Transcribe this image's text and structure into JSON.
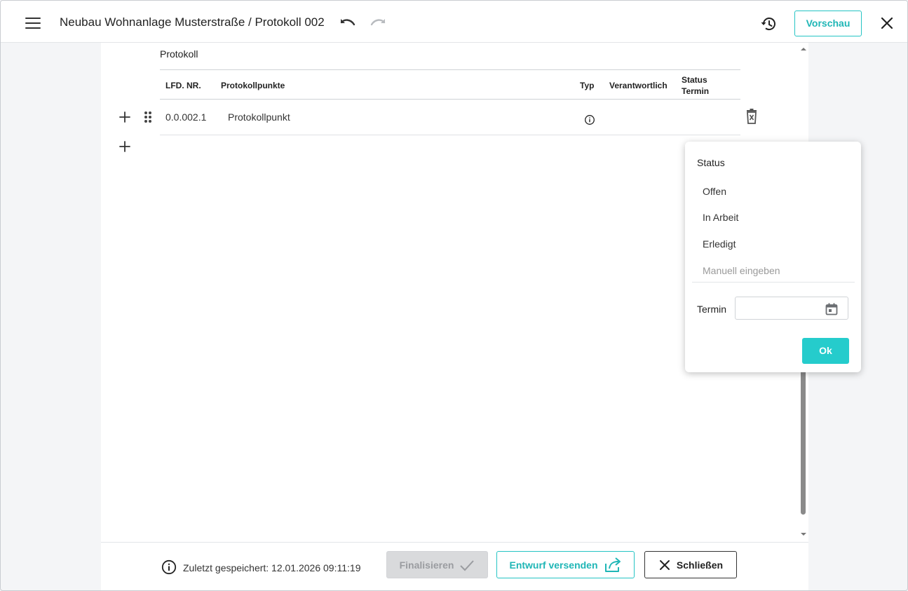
{
  "header": {
    "title": "Neubau Wohnanlage Musterstraße / Protokoll 002",
    "preview_label": "Vorschau"
  },
  "section": {
    "title": "Protokoll"
  },
  "table": {
    "headers": {
      "nr": "LFD. NR.",
      "points": "Protokollpunkte",
      "type": "Typ",
      "responsible": "Verantwortlich",
      "status_line1": "Status",
      "status_line2": "Termin"
    },
    "rows": [
      {
        "nr": "0.0.002.1",
        "point": "Protokollpunkt"
      }
    ]
  },
  "popup": {
    "title": "Status",
    "options": [
      "Offen",
      "In Arbeit",
      "Erledigt"
    ],
    "manual_placeholder": "Manuell eingeben",
    "termin_label": "Termin",
    "termin_value": "",
    "ok_label": "Ok"
  },
  "footer": {
    "saved_text": "Zuletzt gespeichert: 12.01.2026 09:11:19",
    "finalize_label": "Finalisieren",
    "send_draft_label": "Entwurf versenden",
    "close_label": "Schließen"
  },
  "colors": {
    "accent": "#25cccc",
    "background": "#f4f5f7",
    "disabled": "#d9dadc"
  }
}
